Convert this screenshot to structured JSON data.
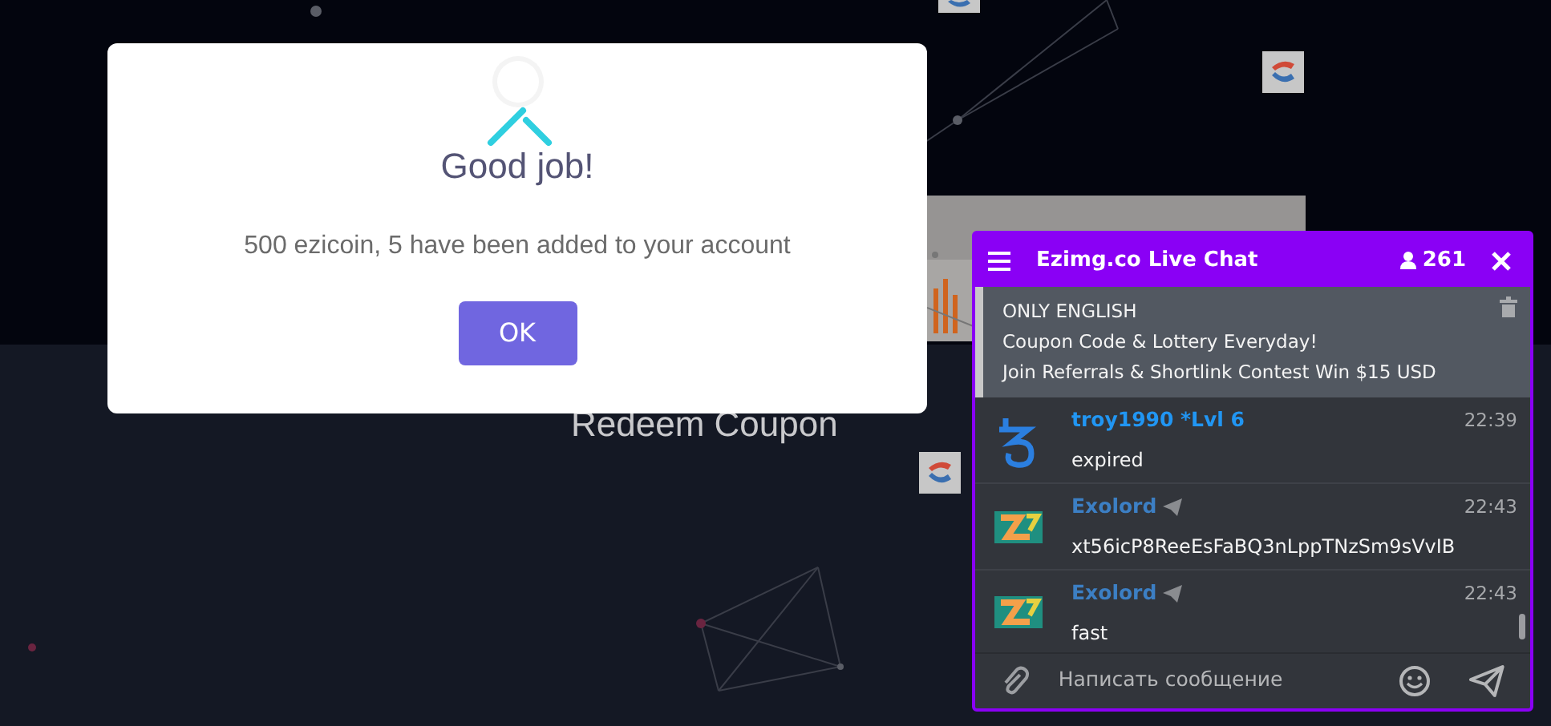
{
  "page": {
    "heading": "Redeem Coupon"
  },
  "modal": {
    "title": "Good job!",
    "message": "500 ezicoin, 5 have been added to your account",
    "button": "OK"
  },
  "chat": {
    "title": "Ezimg.co Live Chat",
    "online_count": "261",
    "pinned": [
      "ONLY ENGLISH",
      "Coupon Code & Lottery Everyday!",
      "Join Referrals & Shortlink Contest Win $15 USD"
    ],
    "messages": [
      {
        "author": "troy1990 *Lvl 6",
        "kind": "site",
        "time": "22:39",
        "text": "expired"
      },
      {
        "author": "Exolord",
        "kind": "telegram",
        "time": "22:43",
        "text": "xt56icP8ReeEsFaBQ3nLppTNzSm9sVvIB"
      },
      {
        "author": "Exolord",
        "kind": "telegram",
        "time": "22:43",
        "text": "fast"
      }
    ],
    "input": {
      "placeholder": "Написать сообщение"
    }
  }
}
